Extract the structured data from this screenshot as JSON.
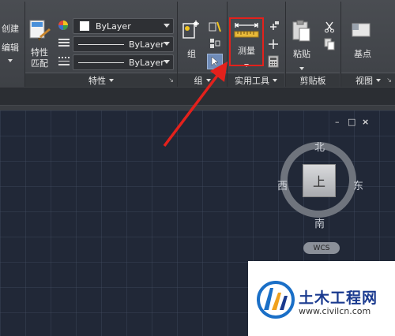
{
  "ribbon": {
    "left_commands": [
      "创建",
      "编辑"
    ],
    "properties_panel": {
      "match_label_line1": "特性",
      "match_label_line2": "匹配",
      "color_dropdown": "ByLayer",
      "linetype_dropdown": "ByLayer",
      "lineweight_dropdown": "ByLayer",
      "footer": "特性"
    },
    "groups_panel": {
      "group_label": "组",
      "footer": "组"
    },
    "utilities_panel": {
      "measure_label": "测量",
      "footer": "实用工具"
    },
    "clipboard_panel": {
      "paste_label": "粘贴",
      "footer": "剪贴板"
    },
    "view_panel": {
      "base_label": "基点",
      "footer": "视图"
    }
  },
  "viewcube": {
    "north": "北",
    "south": "南",
    "east": "东",
    "west": "西",
    "face": "上",
    "ucs": "WCS"
  },
  "viewport_controls": [
    "–",
    "□",
    "×"
  ],
  "watermark": {
    "title": "土木工程网",
    "url": "www.civilcn.com"
  },
  "colors": {
    "highlight": "#e3211c",
    "canvas": "#212837",
    "ribbon": "#44474c"
  }
}
